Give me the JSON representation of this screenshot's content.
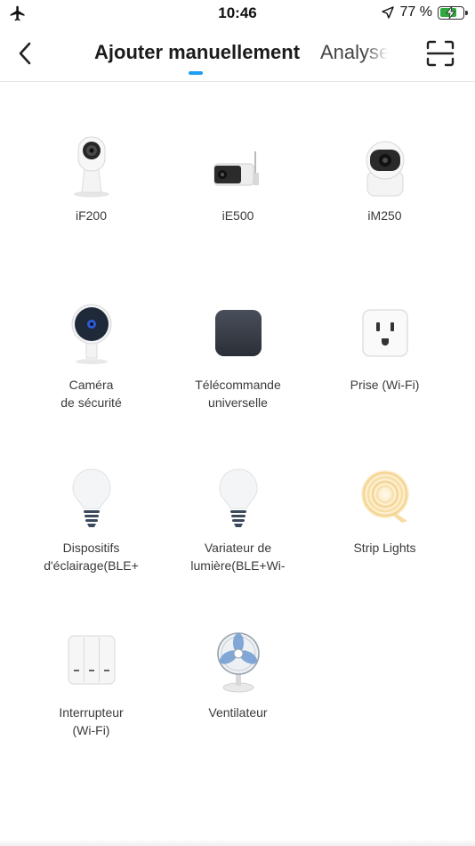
{
  "status_bar": {
    "time": "10:46",
    "battery_pct": "77 %",
    "battery_level": 0.77,
    "icons": [
      "airplane-icon",
      "location-arrow-icon",
      "battery-charging-icon"
    ]
  },
  "header": {
    "tab_active": "Ajouter manuellement",
    "tab_inactive": "Analyse",
    "accent_color": "#1f9ef2",
    "icons": [
      "back-chevron-icon",
      "scan-frame-icon"
    ]
  },
  "devices": [
    {
      "label_line1": "iF200",
      "label_line2": "",
      "icon": "indoor-camera-icon"
    },
    {
      "label_line1": "iE500",
      "label_line2": "",
      "icon": "bullet-camera-icon"
    },
    {
      "label_line1": "iM250",
      "label_line2": "",
      "icon": "dome-camera-icon"
    },
    {
      "label_line1": "Caméra",
      "label_line2": "de sécurité",
      "icon": "security-camera-icon"
    },
    {
      "label_line1": "Télécommande",
      "label_line2": "universelle",
      "icon": "universal-remote-icon"
    },
    {
      "label_line1": "Prise (Wi-Fi)",
      "label_line2": "",
      "icon": "smart-plug-icon"
    },
    {
      "label_line1": "Dispositifs",
      "label_line2": "d'éclairage(BLE+",
      "icon": "light-bulb-icon"
    },
    {
      "label_line1": "Variateur de",
      "label_line2": "lumière(BLE+Wi-",
      "icon": "dimmer-bulb-icon"
    },
    {
      "label_line1": "Strip Lights",
      "label_line2": "",
      "icon": "strip-lights-icon"
    },
    {
      "label_line1": "Interrupteur",
      "label_line2": "(Wi-Fi)",
      "icon": "wall-switch-icon"
    },
    {
      "label_line1": "Ventilateur",
      "label_line2": "",
      "icon": "fan-icon"
    }
  ]
}
